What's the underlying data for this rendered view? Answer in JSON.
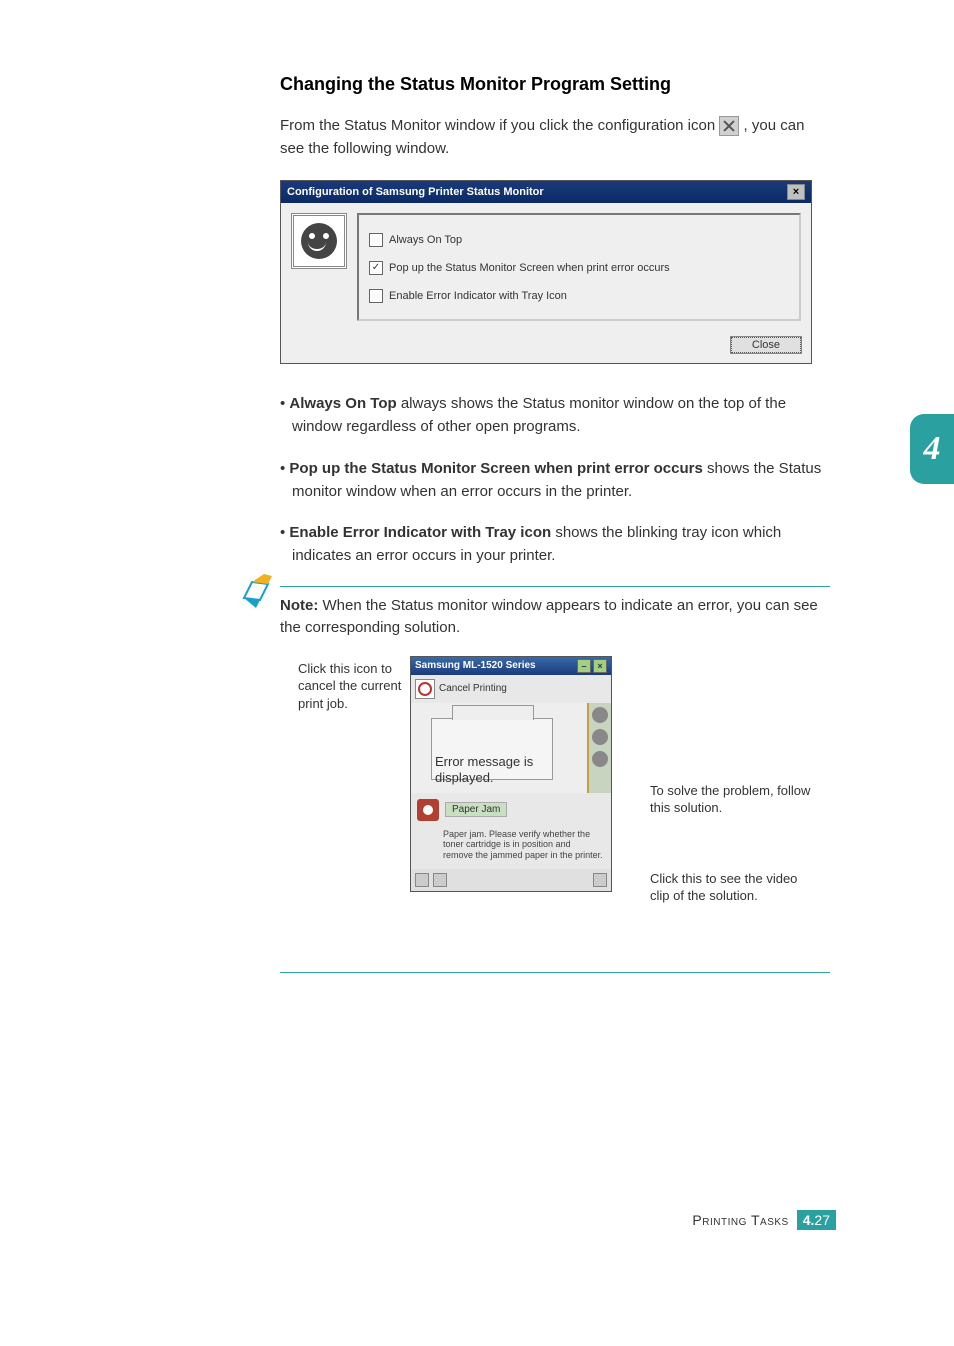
{
  "heading": "Changing the Status Monitor Program Setting",
  "intro_part1": "From the Status Monitor window if you click the configuration icon ",
  "intro_part2": ", you can see the following window.",
  "dialog": {
    "title": "Configuration of Samsung Printer Status Monitor",
    "close_x": "×",
    "options": {
      "opt1": {
        "label": "Always On Top",
        "checked": false
      },
      "opt2": {
        "label": "Pop up the Status Monitor Screen when print error occurs",
        "checked": true
      },
      "opt3": {
        "label": "Enable Error Indicator with Tray Icon",
        "checked": false
      }
    },
    "close_btn": "Close"
  },
  "bullets": {
    "b1_bold": "Always On Top",
    "b1_rest": " always shows the Status monitor window on the top of the window regardless of other open programs.",
    "b2_bold": "Pop up the Status Monitor Screen when print error occurs",
    "b2_rest": " shows the Status monitor window when an error occurs in the printer.",
    "b3_bold": "Enable Error Indicator with Tray icon",
    "b3_rest": " shows the blinking tray icon which indicates an error occurs in your printer."
  },
  "note": {
    "label": "Note:",
    "text": " When the Status monitor window appears to indicate an error, you can see the corresponding solution."
  },
  "callouts": {
    "cancel": "Click this icon to cancel the current print job.",
    "solve": "To solve the problem, follow this solution.",
    "video": "Click this to see the video clip of the solution.",
    "errmsg": "Error message is displayed."
  },
  "status_window": {
    "title": "Samsung ML-1520 Series",
    "min": "–",
    "close": "×",
    "cancel_label": "Cancel Printing",
    "status_label": "Paper Jam",
    "status_desc": "Paper jam. Please verify whether the toner cartridge is in position and remove the jammed paper in the printer."
  },
  "chapter": "4",
  "footer": {
    "label": "Printing Tasks",
    "chapter": "4.",
    "page": "27"
  }
}
